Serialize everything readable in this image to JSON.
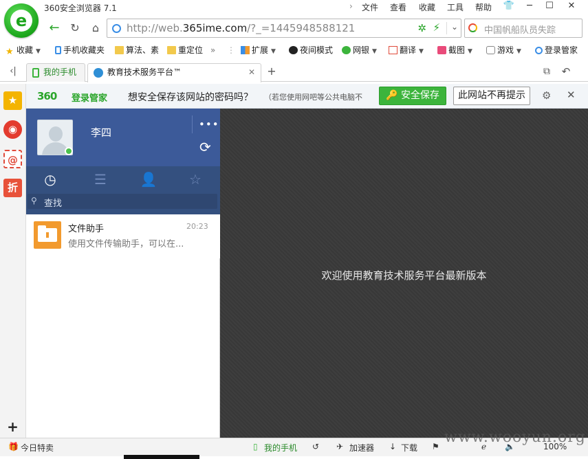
{
  "browser": {
    "title": "360安全浏览器 7.1",
    "menu": [
      "文件",
      "查看",
      "收藏",
      "工具",
      "帮助"
    ],
    "address": {
      "url_prefix": "http://web.",
      "url_domain": "365ime.com",
      "url_suffix": "/?_=1445948588121"
    },
    "search_placeholder": "中国帆船队员失踪"
  },
  "bookmarks": [
    {
      "label": "收藏",
      "icon": "star-icon"
    },
    {
      "label": "手机收藏夹",
      "icon": "phone-icon"
    },
    {
      "label": "算法、素",
      "icon": "folder-icon"
    },
    {
      "label": "重定位",
      "icon": "folder-icon"
    },
    {
      "label": "扩展",
      "icon": "grid-icon"
    },
    {
      "label": "夜间模式",
      "icon": "moon-icon"
    },
    {
      "label": "网银",
      "icon": "bank-icon"
    },
    {
      "label": "翻译",
      "icon": "translate-icon"
    },
    {
      "label": "截图",
      "icon": "scissors-icon"
    },
    {
      "label": "游戏",
      "icon": "gamepad-icon"
    },
    {
      "label": "登录管家",
      "icon": "key-icon"
    }
  ],
  "tabs": [
    {
      "label": "我的手机"
    },
    {
      "label": "教育技术服务平台™"
    }
  ],
  "password_bar": {
    "brand_num": "360",
    "brand_text": "登录管家",
    "question": "想安全保存该网站的密码吗？",
    "note": "（若您使用网吧等公共电脑不",
    "save_label": "安全保存",
    "never_label": "此网站不再提示"
  },
  "sidebar": [
    "star",
    "weibo",
    "email",
    "discount"
  ],
  "sidebar_text": {
    "email": "@",
    "discount": "折"
  },
  "user": {
    "name": "李四"
  },
  "search": {
    "placeholder": "查找"
  },
  "conversations": [
    {
      "name": "文件助手",
      "time": "20:23",
      "preview": "使用文件传输助手，可以在..."
    }
  ],
  "welcome": "欢迎使用教育技术服务平台最新版本",
  "statusbar": {
    "deal": "今日特卖",
    "phone": "我的手机",
    "accelerator": "加速器",
    "download": "下载",
    "zoom": "100%"
  },
  "watermark": "www.wooyun.org"
}
